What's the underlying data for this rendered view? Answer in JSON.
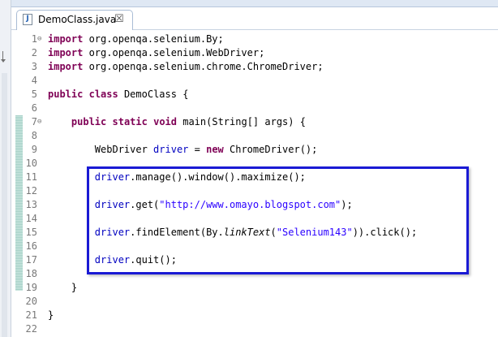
{
  "editor_tab": {
    "title": "DemoClass.java",
    "file_icon": "java-file-icon",
    "file_icon_glyph": "J",
    "close_glyph": "☒"
  },
  "code_lines": [
    {
      "num": "1",
      "fold": "⊖",
      "code": [
        {
          "t": "import",
          "c": "kw"
        },
        {
          "t": " org.openqa.selenium.By;",
          "c": ""
        }
      ]
    },
    {
      "num": "2",
      "fold": "",
      "code": [
        {
          "t": "import",
          "c": "kw"
        },
        {
          "t": " org.openqa.selenium.WebDriver;",
          "c": ""
        }
      ]
    },
    {
      "num": "3",
      "fold": "",
      "code": [
        {
          "t": "import",
          "c": "kw"
        },
        {
          "t": " org.openqa.selenium.chrome.ChromeDriver;",
          "c": ""
        }
      ]
    },
    {
      "num": "4",
      "fold": "",
      "code": []
    },
    {
      "num": "5",
      "fold": "",
      "code": [
        {
          "t": "public",
          "c": "kw"
        },
        {
          "t": " ",
          "c": ""
        },
        {
          "t": "class",
          "c": "kw"
        },
        {
          "t": " DemoClass {",
          "c": ""
        }
      ]
    },
    {
      "num": "6",
      "fold": "",
      "code": []
    },
    {
      "num": "7",
      "fold": "⊖",
      "code": [
        {
          "t": "    ",
          "c": ""
        },
        {
          "t": "public",
          "c": "kw"
        },
        {
          "t": " ",
          "c": ""
        },
        {
          "t": "static",
          "c": "kw"
        },
        {
          "t": " ",
          "c": ""
        },
        {
          "t": "void",
          "c": "kw"
        },
        {
          "t": " main(String[] args) {",
          "c": ""
        }
      ]
    },
    {
      "num": "8",
      "fold": "",
      "code": []
    },
    {
      "num": "9",
      "fold": "",
      "code": [
        {
          "t": "        WebDriver ",
          "c": ""
        },
        {
          "t": "driver",
          "c": "fld"
        },
        {
          "t": " = ",
          "c": ""
        },
        {
          "t": "new",
          "c": "kw"
        },
        {
          "t": " ChromeDriver();",
          "c": ""
        }
      ]
    },
    {
      "num": "10",
      "fold": "",
      "code": []
    },
    {
      "num": "11",
      "fold": "",
      "code": [
        {
          "t": "        ",
          "c": ""
        },
        {
          "t": "driver",
          "c": "fld"
        },
        {
          "t": ".manage().window().maximize();",
          "c": ""
        }
      ]
    },
    {
      "num": "12",
      "fold": "",
      "code": []
    },
    {
      "num": "13",
      "fold": "",
      "code": [
        {
          "t": "        ",
          "c": ""
        },
        {
          "t": "driver",
          "c": "fld"
        },
        {
          "t": ".get(",
          "c": ""
        },
        {
          "t": "\"http://www.omayo.blogspot.com\"",
          "c": "str"
        },
        {
          "t": ");",
          "c": ""
        }
      ]
    },
    {
      "num": "14",
      "fold": "",
      "code": []
    },
    {
      "num": "15",
      "fold": "",
      "code": [
        {
          "t": "        ",
          "c": ""
        },
        {
          "t": "driver",
          "c": "fld"
        },
        {
          "t": ".findElement(By.",
          "c": ""
        },
        {
          "t": "linkText",
          "c": "it"
        },
        {
          "t": "(",
          "c": ""
        },
        {
          "t": "\"Selenium143\"",
          "c": "str"
        },
        {
          "t": ")).click();",
          "c": ""
        }
      ]
    },
    {
      "num": "16",
      "fold": "",
      "code": []
    },
    {
      "num": "17",
      "fold": "",
      "code": [
        {
          "t": "        ",
          "c": ""
        },
        {
          "t": "driver",
          "c": "fld"
        },
        {
          "t": ".quit();",
          "c": ""
        }
      ]
    },
    {
      "num": "18",
      "fold": "",
      "code": []
    },
    {
      "num": "19",
      "fold": "",
      "code": [
        {
          "t": "    }",
          "c": ""
        }
      ]
    },
    {
      "num": "20",
      "fold": "",
      "code": []
    },
    {
      "num": "21",
      "fold": "",
      "code": [
        {
          "t": "}",
          "c": ""
        }
      ]
    },
    {
      "num": "22",
      "fold": "",
      "code": []
    }
  ],
  "colors": {
    "keyword": "#7f0055",
    "field": "#0000c0",
    "string": "#2a00ff",
    "line_number": "#787878",
    "highlight_box": "#1a1ad4",
    "change_bar": "#a5d0c7"
  }
}
